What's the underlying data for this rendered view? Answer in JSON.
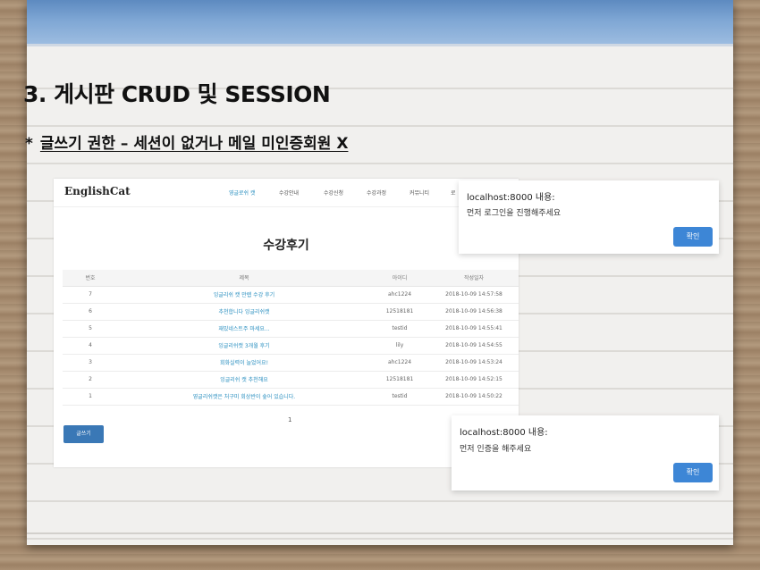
{
  "slide": {
    "title": "3. 게시판 CRUD 및 SESSION",
    "subtitle_prefix": "*",
    "subtitle": "글쓰기 권한 – 세션이 없거나 메일 미인증회원 X"
  },
  "site": {
    "brand": "EnglishCat",
    "nav": [
      "영글로쉬 캣",
      "수강안내",
      "수강신청",
      "수강과정",
      "커뮤니티",
      "로"
    ],
    "board_title": "수강후기",
    "columns": [
      "번호",
      "제목",
      "아이디",
      "작성일자"
    ],
    "rows": [
      {
        "no": "7",
        "title": "잉글리쉬 캣 만렙 수강 후기",
        "id": "ahc1224",
        "date": "2018-10-09 14:57:58"
      },
      {
        "no": "6",
        "title": "추천합니다 잉글리쉬캣",
        "id": "12518181",
        "date": "2018-10-09 14:56:38"
      },
      {
        "no": "5",
        "title": "재밌네스트주 마세요...",
        "id": "testid",
        "date": "2018-10-09 14:55:41"
      },
      {
        "no": "4",
        "title": "잉글리쉬캣 3개월 후기",
        "id": "lily",
        "date": "2018-10-09 14:54:55"
      },
      {
        "no": "3",
        "title": "회화실력이 늘었어요!",
        "id": "ahc1224",
        "date": "2018-10-09 14:53:24"
      },
      {
        "no": "2",
        "title": "잉글리쉬 캣 추천해요",
        "id": "12518181",
        "date": "2018-10-09 14:52:15"
      },
      {
        "no": "1",
        "title": "영글리쉬캣은 처구미 회상반이 숲어 있습니다.",
        "id": "testid",
        "date": "2018-10-09 14:50:22"
      }
    ],
    "page": "1",
    "write_button": "글쓰기"
  },
  "dialogs": [
    {
      "host": "localhost:8000 내용:",
      "message": "먼저 로그인을 진행해주세요",
      "ok": "확인"
    },
    {
      "host": "localhost:8000 내용:",
      "message": "먼저 인증을 해주세요",
      "ok": "확인"
    }
  ],
  "colors": {
    "header_blue": "#6f98cb",
    "link_blue": "#2a8fc0",
    "button_blue": "#3d86d6"
  }
}
